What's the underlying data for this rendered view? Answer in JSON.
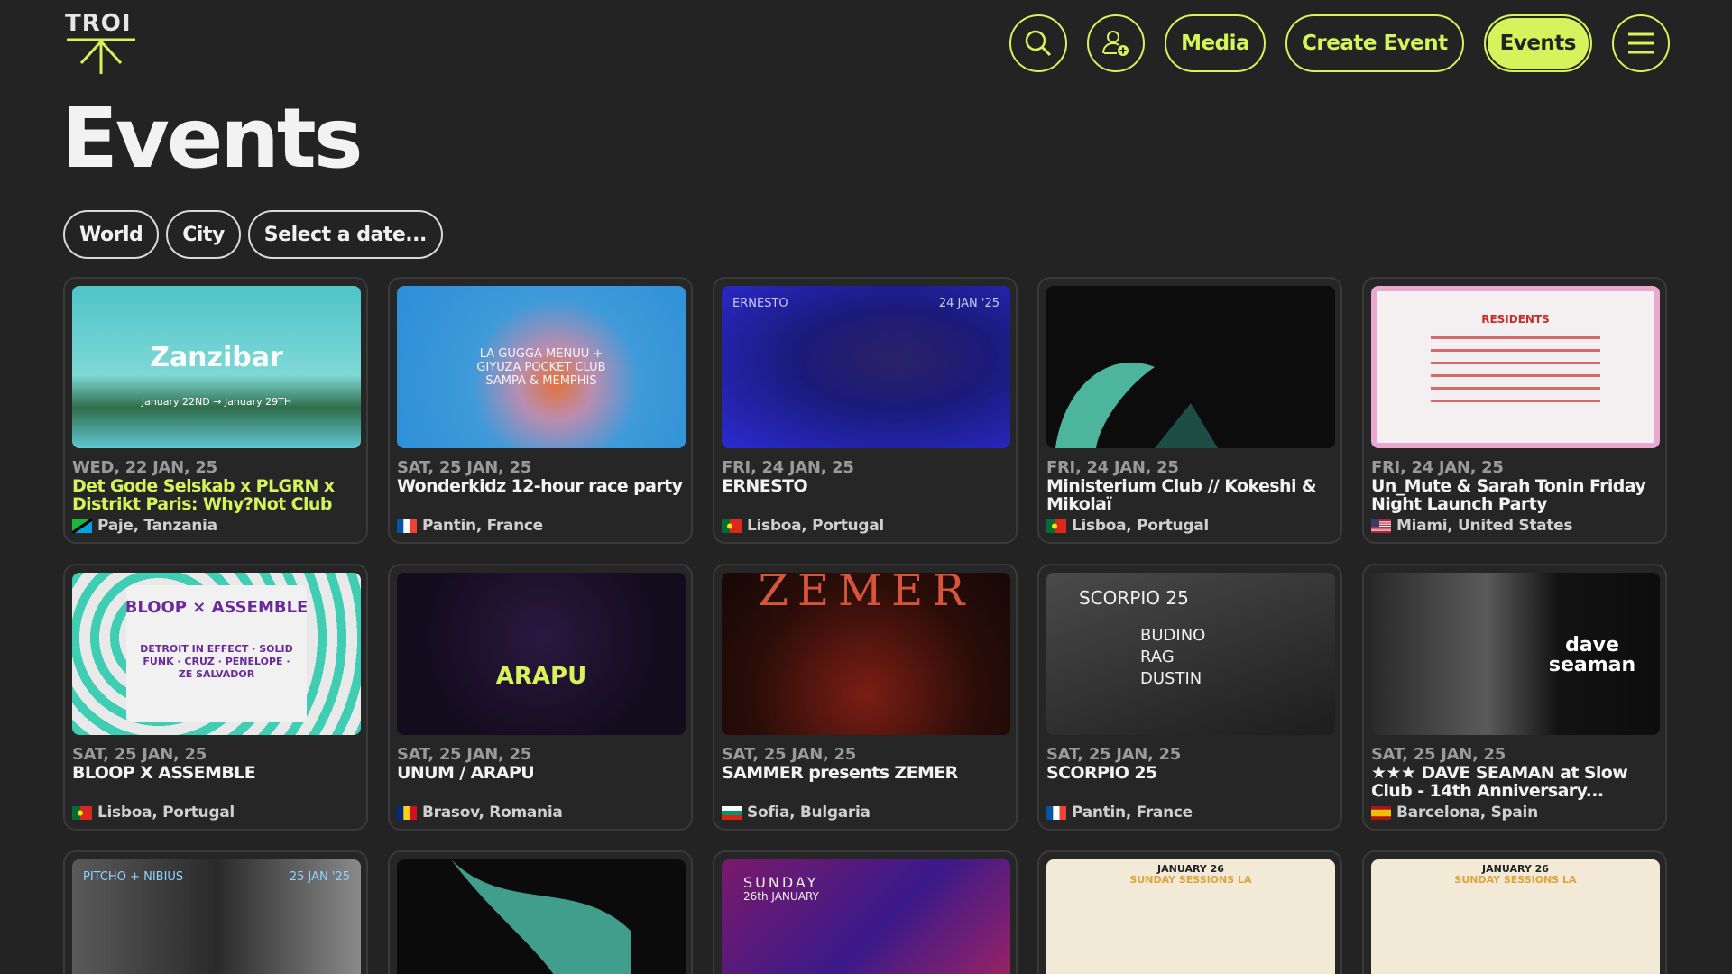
{
  "brand": {
    "logo_text": "TROI"
  },
  "nav": {
    "media": "Media",
    "create_event": "Create Event",
    "events": "Events",
    "accent": "#d7f25a"
  },
  "page": {
    "title": "Events"
  },
  "filters": {
    "world": "World",
    "city": "City",
    "date": "Select a date..."
  },
  "events": [
    {
      "date": "WED, 22 JAN, 25",
      "title": "Det Gode Selskab x PLGRN x Distrikt Paris: Why?Not Club",
      "location": "Paje, Tanzania",
      "thumb_text": "Zanzibar",
      "thumb_sub": "January 22ND → January 29TH"
    },
    {
      "date": "SAT, 25 JAN, 25",
      "title": "Wonderkidz 12-hour race party",
      "location": "Pantin, France",
      "thumb_text": "LA GUGGA  MENUU + GIYUZA  POCKET CLUB  SAMPA & MEMPHIS"
    },
    {
      "date": "FRI, 24 JAN, 25",
      "title": "ERNESTO",
      "location": "Lisboa, Portugal",
      "thumb_text": "ERNESTO",
      "thumb_sub": "24 JAN '25"
    },
    {
      "date": "FRI, 24 JAN, 25",
      "title": "Ministerium Club // Kokeshi & Mikolaï",
      "location": "Lisboa, Portugal"
    },
    {
      "date": "FRI, 24 JAN, 25",
      "title": "Un_Mute & Sarah Tonin Friday Night Launch Party",
      "location": "Miami, United States",
      "thumb_text": "RESIDENTS"
    },
    {
      "date": "SAT, 25 JAN, 25",
      "title": "BLOOP X ASSEMBLE",
      "location": "Lisboa, Portugal",
      "thumb_text": "BLOOP × ASSEMBLE",
      "thumb_sub": "DETROIT IN EFFECT · SOLID FUNK · CRUZ · PENELOPE · ZE SALVADOR"
    },
    {
      "date": "SAT, 25 JAN, 25",
      "title": "UNUM / ARAPU",
      "location": "Brasov, Romania",
      "thumb_text": "ARAPU"
    },
    {
      "date": "SAT, 25 JAN, 25",
      "title": "SAMMER presents ZEMER",
      "location": "Sofia, Bulgaria",
      "thumb_text": "ZEMER"
    },
    {
      "date": "SAT, 25 JAN, 25",
      "title": "SCORPIO 25",
      "location": "Pantin, France",
      "thumb_text": "SCORPIO 25",
      "thumb_sub": "BUDINO RAG DUSTIN"
    },
    {
      "date": "SAT, 25 JAN, 25",
      "title": "★★★ DAVE SEAMAN at Slow Club - 14th Anniversary...",
      "location": "Barcelona, Spain",
      "thumb_text": "dave seaman"
    },
    {
      "thumb_text": "PITCHO + NIBIUS",
      "thumb_sub": "25 JAN '25"
    },
    {
      "thumb_text": ""
    },
    {
      "thumb_text": "SUNDAY",
      "thumb_sub": "26th JANUARY"
    },
    {
      "thumb_text": "JANUARY 26",
      "thumb_sub": "SUNDAY SESSIONS LA"
    },
    {
      "thumb_text": "JANUARY 26",
      "thumb_sub": "SUNDAY SESSIONS LA"
    }
  ]
}
